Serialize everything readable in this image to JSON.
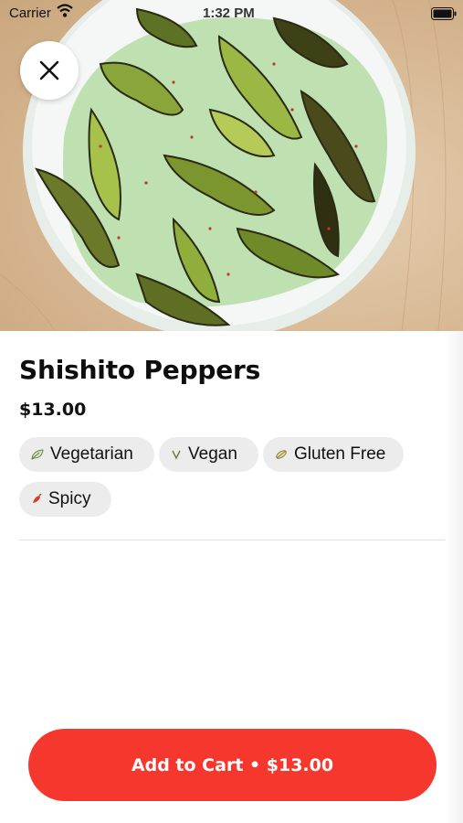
{
  "status_bar": {
    "carrier": "Carrier",
    "time": "1:32 PM"
  },
  "item": {
    "name": "Shishito Peppers",
    "price": "$13.00",
    "tags": [
      {
        "label": "Vegetarian",
        "icon": "leaf-icon"
      },
      {
        "label": "Vegan",
        "icon": "vegan-v-icon"
      },
      {
        "label": "Gluten Free",
        "icon": "wheat-free-icon"
      },
      {
        "label": "Spicy",
        "icon": "chili-pepper-icon"
      }
    ]
  },
  "cart_button": {
    "label": "Add to Cart • $13.00"
  },
  "colors": {
    "accent": "#f6372d",
    "tag_bg": "#ececec",
    "sauce": "#bfe0b0"
  }
}
